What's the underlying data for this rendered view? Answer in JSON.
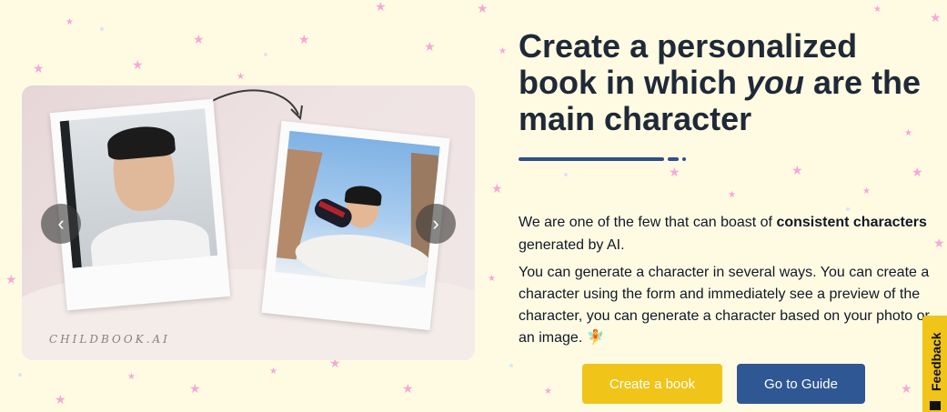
{
  "headline": {
    "part1": "Create a personalized book in which ",
    "emphasis": "you",
    "part2": " are the main character"
  },
  "intro": {
    "lead": "We are one of the few that can boast of ",
    "bold": "consistent characters",
    "tail": " generated by AI."
  },
  "description": "You can generate a character in several ways. You can create a character using the form and immediately see a preview of the character, you can generate a character based on your photo or an image.",
  "description_emoji": "🧚",
  "carousel": {
    "watermark": "CHILDBOOK.AI",
    "prev_icon": "‹",
    "next_icon": "›"
  },
  "buttons": {
    "create": "Create a book",
    "guide": "Go to Guide"
  },
  "feedback_tab": "Feedback",
  "colors": {
    "accent_yellow": "#f0c419",
    "accent_blue": "#2e5793",
    "background": "#fffbe3"
  }
}
